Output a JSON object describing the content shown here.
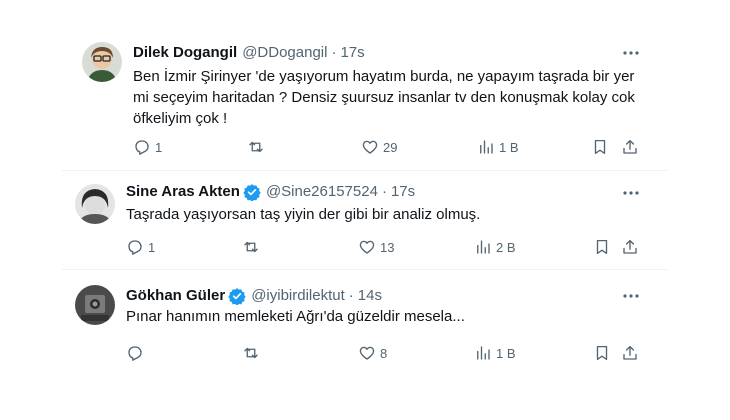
{
  "tweets": [
    {
      "name": "Dilek Dogangil",
      "handle": "@DDogangil",
      "time": "17s",
      "text": "Ben İzmir Şirinyer 'de yaşıyorum hayatım burda, ne yapayım taşrada bir yer mi seçeyim haritadan ? Densiz şuursuz insanlar tv den konuşmak kolay cok öfkeliyim çok !",
      "verified": false,
      "replies": "1",
      "reposts": "",
      "likes": "29",
      "views": "1 B"
    },
    {
      "name": "Sine Aras Akten",
      "handle": "@Sine26157524",
      "time": "17s",
      "text": "Taşrada yaşıyorsan taş yiyin der gibi bir analiz olmuş.",
      "verified": true,
      "replies": "1",
      "reposts": "",
      "likes": "13",
      "views": "2 B"
    },
    {
      "name": "Gökhan Güler",
      "handle": "@iyibirdilektut",
      "time": "14s",
      "text": "Pınar hanımın memleketi Ağrı'da güzeldir mesela...",
      "verified": true,
      "replies": "",
      "reposts": "",
      "likes": "8",
      "views": "1 B"
    }
  ],
  "dot": "·",
  "colors": {
    "text": "#0f1419",
    "secondary": "#536471",
    "verified": "#1d9bf0",
    "divider": "#eff3f4"
  },
  "icons": [
    "avatar",
    "verified-badge-icon",
    "more-icon",
    "reply-icon",
    "repost-icon",
    "like-icon",
    "views-icon",
    "bookmark-icon",
    "share-icon"
  ]
}
